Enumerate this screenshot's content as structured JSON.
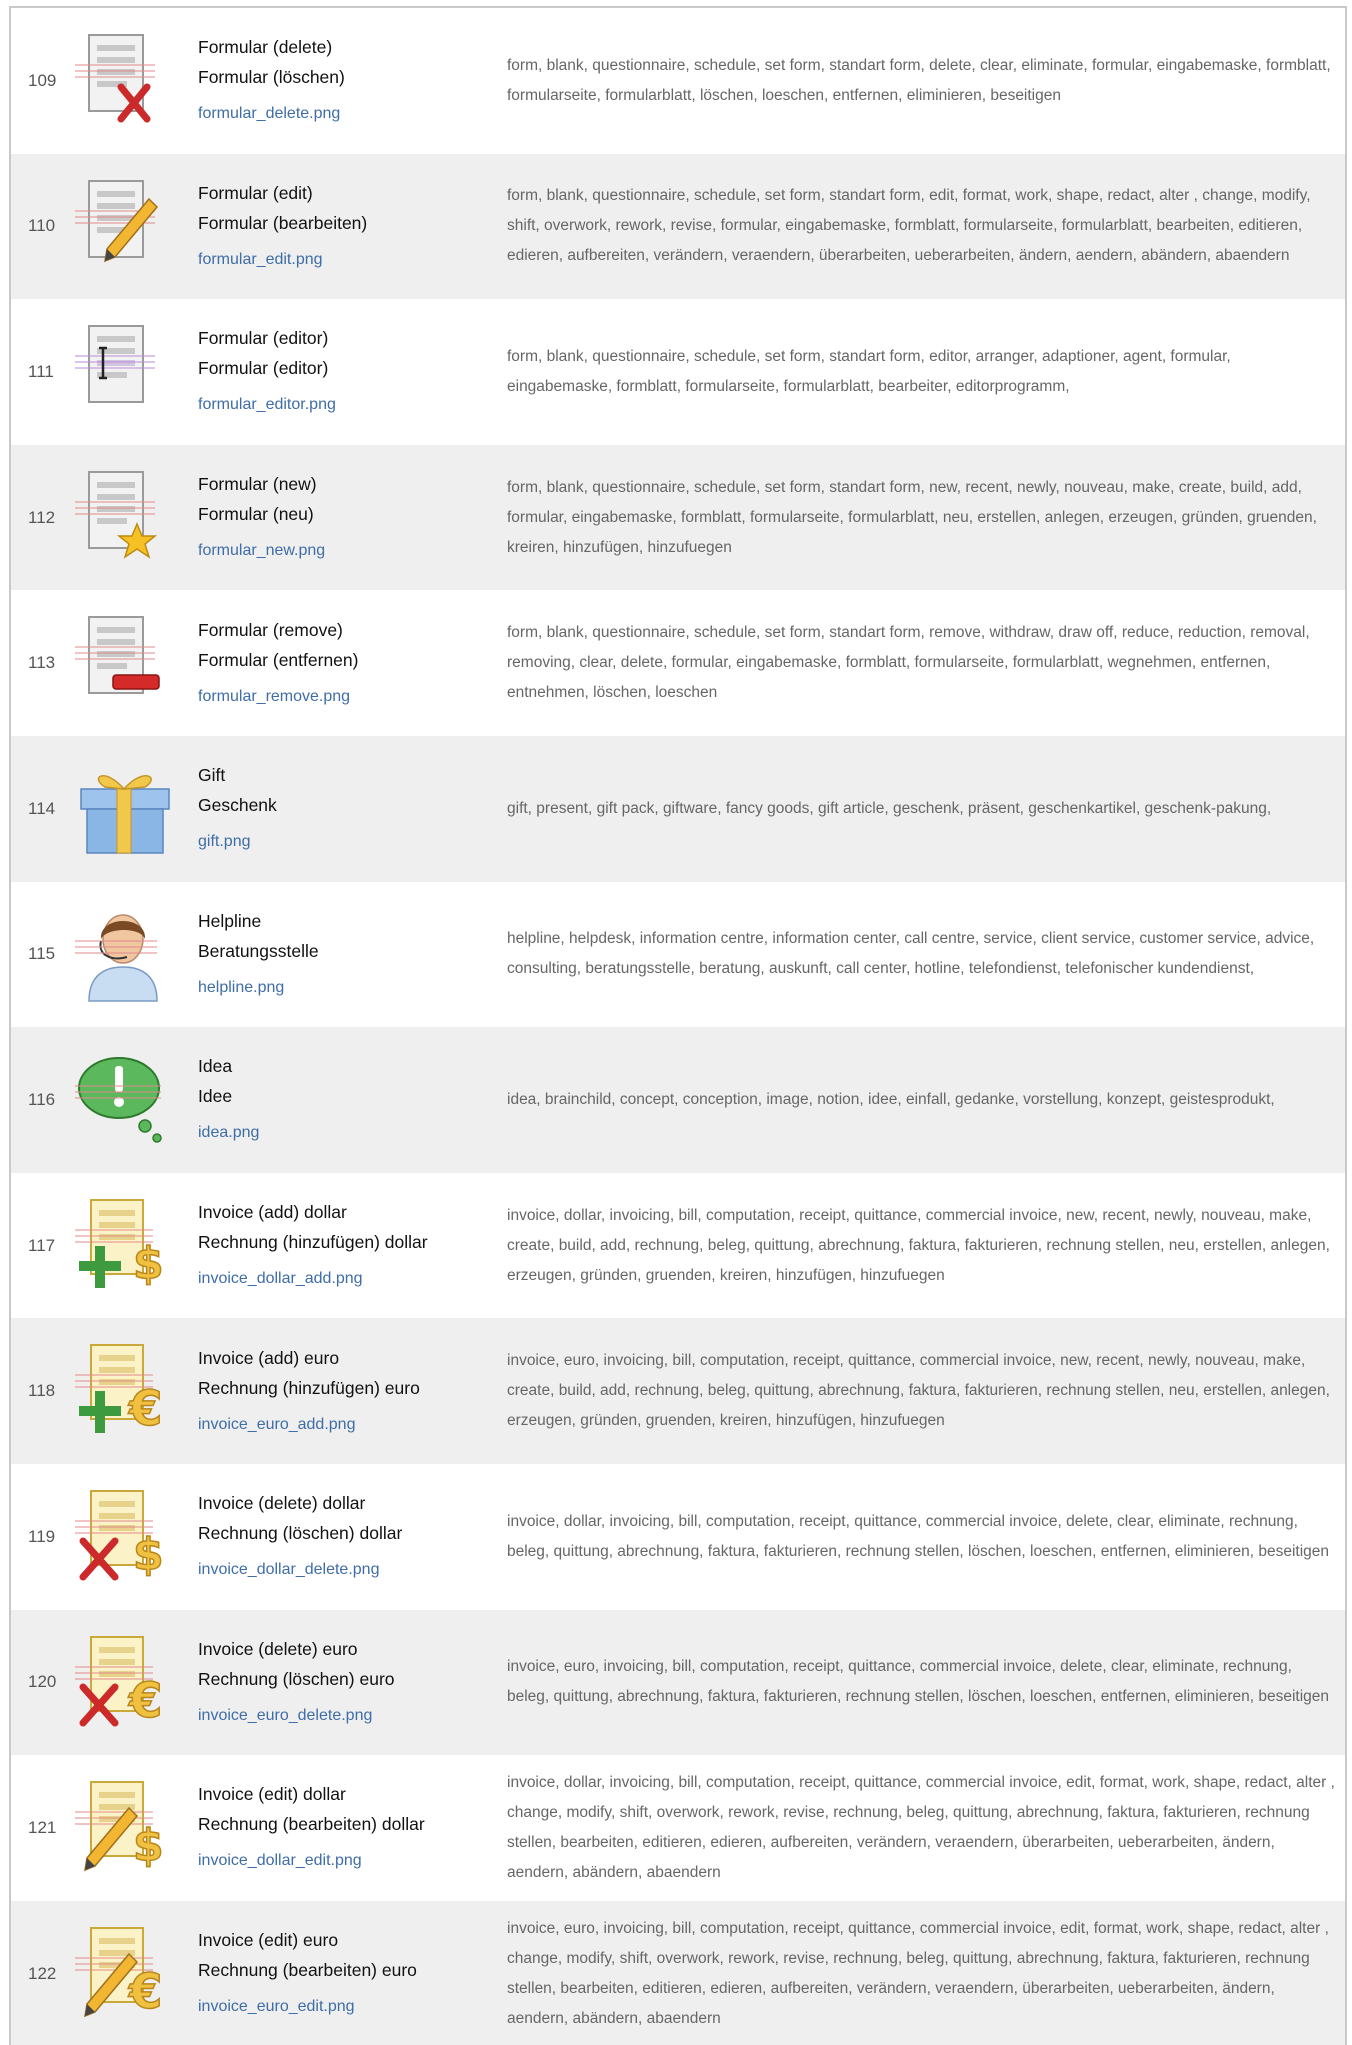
{
  "rows": [
    {
      "num": "109",
      "en": "Formular (delete)",
      "de": "Formular (löschen)",
      "file": "formular_delete.png",
      "icon": "form-delete-icon",
      "tags": "form, blank, questionnaire, schedule, set form, standart form, delete, clear, eliminate, formular, eingabemaske, formblatt, formularseite, formularblatt, löschen, loeschen, entfernen, eliminieren, beseitigen"
    },
    {
      "num": "110",
      "en": "Formular (edit)",
      "de": "Formular (bearbeiten)",
      "file": "formular_edit.png",
      "icon": "form-edit-icon",
      "tags": "form, blank, questionnaire, schedule, set form, standart form, edit, format, work, shape, redact, alter , change, modify, shift, overwork, rework, revise, formular, eingabemaske, formblatt, formularseite, formularblatt, bearbeiten, editieren, edieren, aufbereiten, verändern, veraendern, überarbeiten, ueberarbeiten, ändern, aendern, abändern, abaendern"
    },
    {
      "num": "111",
      "en": "Formular (editor)",
      "de": "Formular (editor)",
      "file": "formular_editor.png",
      "icon": "form-editor-icon",
      "tags": "form, blank, questionnaire, schedule, set form, standart form, editor, arranger, adaptioner, agent, formular, eingabemaske, formblatt, formularseite, formularblatt, bearbeiter, editorprogramm,"
    },
    {
      "num": "112",
      "en": "Formular (new)",
      "de": "Formular (neu)",
      "file": "formular_new.png",
      "icon": "form-new-icon",
      "tags": "form, blank, questionnaire, schedule, set form, standart form, new, recent, newly, nouveau, make, create, build, add, formular, eingabemaske, formblatt, formularseite, formularblatt, neu, erstellen, anlegen, erzeugen, gründen, gruenden, kreiren, hinzufügen, hinzufuegen"
    },
    {
      "num": "113",
      "en": "Formular (remove)",
      "de": "Formular (entfernen)",
      "file": "formular_remove.png",
      "icon": "form-remove-icon",
      "tags": "form, blank, questionnaire, schedule, set form, standart form, remove, withdraw, draw off, reduce, reduction, removal, removing, clear, delete, formular, eingabemaske, formblatt, formularseite, formularblatt, wegnehmen, entfernen, entnehmen, löschen, loeschen"
    },
    {
      "num": "114",
      "en": "Gift",
      "de": "Geschenk",
      "file": "gift.png",
      "icon": "gift-icon",
      "tags": "gift, present, gift pack, giftware, fancy goods, gift article, geschenk, präsent, geschenkartikel, geschenk-pakung,"
    },
    {
      "num": "115",
      "en": "Helpline",
      "de": "Beratungsstelle",
      "file": "helpline.png",
      "icon": "helpline-icon",
      "tags": "helpline, helpdesk, information centre, information center, call centre, service, client service, customer service, advice, consulting, beratungsstelle, beratung, auskunft, call center, hotline, telefondienst, telefonischer kundendienst,"
    },
    {
      "num": "116",
      "en": "Idea",
      "de": "Idee",
      "file": "idea.png",
      "icon": "idea-icon",
      "tags": "idea, brainchild, concept, conception, image, notion, idee, einfall, gedanke, vorstellung, konzept, geistesprodukt,"
    },
    {
      "num": "117",
      "en": "Invoice (add) dollar",
      "de": "Rechnung (hinzufügen) dollar",
      "file": "invoice_dollar_add.png",
      "icon": "invoice-dollar-add-icon",
      "tags": "invoice, dollar, invoicing, bill, computation, receipt, quittance, commercial invoice, new, recent, newly, nouveau, make, create, build, add, rechnung, beleg, quittung, abrechnung, faktura, fakturieren, rechnung stellen, neu, erstellen, anlegen, erzeugen, gründen, gruenden, kreiren, hinzufügen, hinzufuegen"
    },
    {
      "num": "118",
      "en": "Invoice (add) euro",
      "de": "Rechnung (hinzufügen) euro",
      "file": "invoice_euro_add.png",
      "icon": "invoice-euro-add-icon",
      "tags": "invoice, euro, invoicing, bill, computation, receipt, quittance, commercial invoice, new, recent, newly, nouveau, make, create, build, add, rechnung, beleg, quittung, abrechnung, faktura, fakturieren, rechnung stellen, neu, erstellen, anlegen, erzeugen, gründen, gruenden, kreiren, hinzufügen, hinzufuegen"
    },
    {
      "num": "119",
      "en": "Invoice (delete) dollar",
      "de": "Rechnung (löschen) dollar",
      "file": "invoice_dollar_delete.png",
      "icon": "invoice-dollar-delete-icon",
      "tags": "invoice, dollar, invoicing, bill, computation, receipt, quittance, commercial invoice, delete, clear, eliminate, rechnung, beleg, quittung, abrechnung, faktura, fakturieren, rechnung stellen, löschen, loeschen, entfernen, eliminieren, beseitigen"
    },
    {
      "num": "120",
      "en": "Invoice (delete) euro",
      "de": "Rechnung (löschen) euro",
      "file": "invoice_euro_delete.png",
      "icon": "invoice-euro-delete-icon",
      "tags": "invoice, euro, invoicing, bill, computation, receipt, quittance, commercial invoice, delete, clear, eliminate, rechnung, beleg, quittung, abrechnung, faktura, fakturieren, rechnung stellen, löschen, loeschen, entfernen, eliminieren, beseitigen"
    },
    {
      "num": "121",
      "en": "Invoice (edit) dollar",
      "de": "Rechnung (bearbeiten) dollar",
      "file": "invoice_dollar_edit.png",
      "icon": "invoice-dollar-edit-icon",
      "tags": "invoice, dollar, invoicing, bill, computation, receipt, quittance, commercial invoice, edit, format, work, shape, redact, alter , change, modify, shift, overwork, rework, revise, rechnung, beleg, quittung, abrechnung, faktura, fakturieren, rechnung stellen, bearbeiten, editieren, edieren, aufbereiten, verändern, veraendern, überarbeiten, ueberarbeiten, ändern, aendern, abändern, abaendern"
    },
    {
      "num": "122",
      "en": "Invoice (edit) euro",
      "de": "Rechnung (bearbeiten) euro",
      "file": "invoice_euro_edit.png",
      "icon": "invoice-euro-edit-icon",
      "tags": "invoice, euro, invoicing, bill, computation, receipt, quittance, commercial invoice, edit, format, work, shape, redact, alter , change, modify, shift, overwork, rework, revise, rechnung, beleg, quittung, abrechnung, faktura, fakturieren, rechnung stellen, bearbeiten, editieren, edieren, aufbereiten, verändern, veraendern, überarbeiten, ueberarbeiten, ändern, aendern, abändern, abaendern"
    }
  ]
}
